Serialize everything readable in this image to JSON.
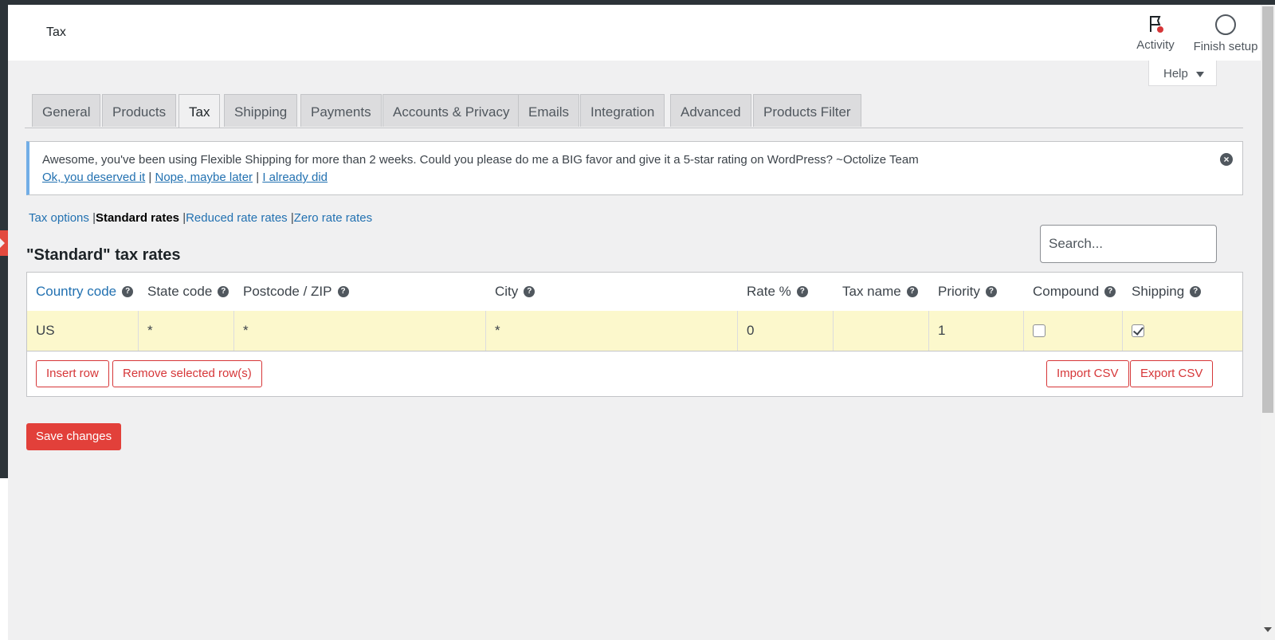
{
  "header": {
    "title": "Tax",
    "activity_label": "Activity",
    "finish_setup_label": "Finish setup"
  },
  "help": {
    "label": "Help"
  },
  "tabs": [
    {
      "label": "General"
    },
    {
      "label": "Products"
    },
    {
      "label": "Tax"
    },
    {
      "label": "Shipping"
    },
    {
      "label": "Payments"
    },
    {
      "label": "Accounts & Privacy"
    },
    {
      "label": "Emails"
    },
    {
      "label": "Integration"
    },
    {
      "label": "Advanced"
    },
    {
      "label": "Products Filter"
    }
  ],
  "active_tab": "Tax",
  "notice": {
    "text": "Awesome, you've been using Flexible Shipping for more than 2 weeks. Could you please do me a BIG favor and give it a 5-star rating on WordPress? ~Octolize Team",
    "link_ok": "Ok, you deserved it",
    "link_later": "Nope, maybe later",
    "link_did": "I already did",
    "separator": "|"
  },
  "subnav": {
    "tax_options": "Tax options",
    "standard_rates": "Standard rates",
    "reduced_rates": "Reduced rate rates",
    "zero_rates": "Zero rate rates",
    "separator": "|"
  },
  "section": {
    "title": "\"Standard\" tax rates",
    "search_placeholder": "Search..."
  },
  "table": {
    "columns": [
      "Country code",
      "State code",
      "Postcode / ZIP",
      "City",
      "Rate %",
      "Tax name",
      "Priority",
      "Compound",
      "Shipping"
    ],
    "rows": [
      {
        "country": "US",
        "state": "*",
        "postcode": "*",
        "city": "*",
        "rate": "0",
        "tax_name": "",
        "priority": "1",
        "compound": false,
        "shipping": true
      }
    ],
    "help_glyph": "?"
  },
  "buttons": {
    "insert_row": "Insert row",
    "remove_rows": "Remove selected row(s)",
    "import_csv": "Import CSV",
    "export_csv": "Export CSV",
    "save": "Save changes"
  },
  "colors": {
    "accent": "#2271b1",
    "danger": "#d63638",
    "save_bg": "#e2403a",
    "row_highlight": "#fcf8cc",
    "notice_border": "#72aee6"
  }
}
